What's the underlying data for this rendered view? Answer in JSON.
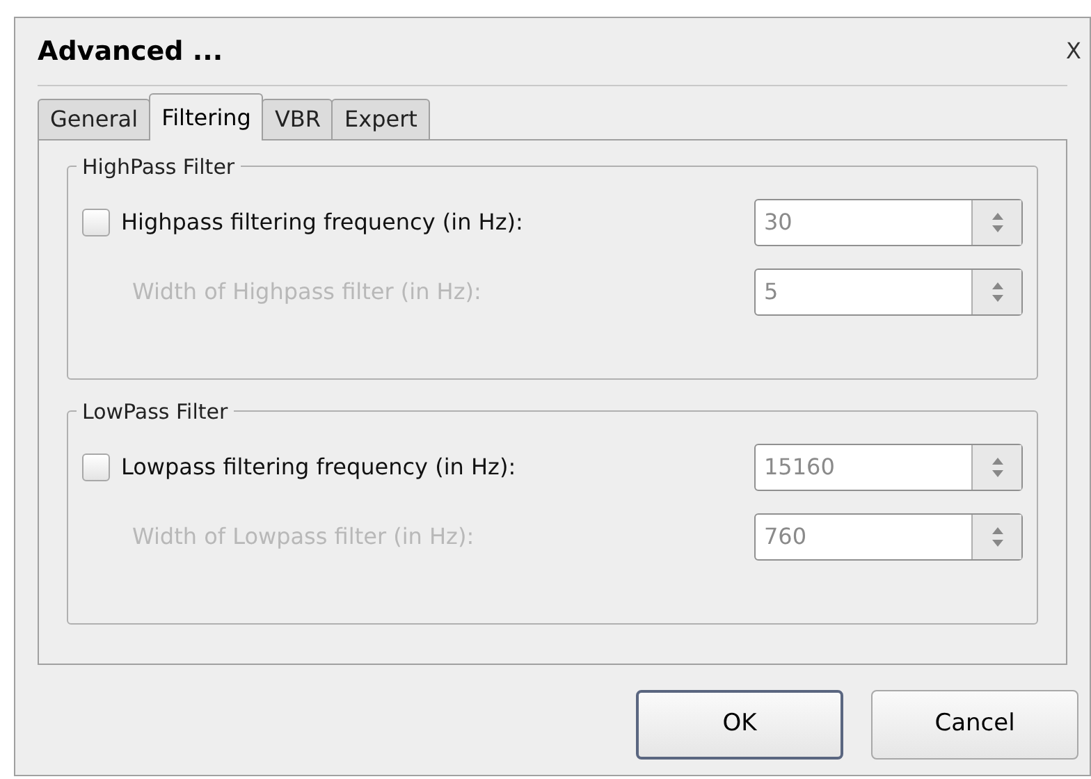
{
  "window": {
    "title": "Advanced ...",
    "close": "X"
  },
  "tabs": [
    {
      "label": "General",
      "selected": false
    },
    {
      "label": "Filtering",
      "selected": true
    },
    {
      "label": "VBR",
      "selected": false
    },
    {
      "label": "Expert",
      "selected": false
    }
  ],
  "groups": [
    {
      "title": "HighPass Filter",
      "rows": [
        {
          "kind": "checkbox",
          "label": "Highpass filtering frequency (in Hz):",
          "checked": false,
          "disabled": false,
          "field": {
            "value": "30",
            "disabled": true
          }
        },
        {
          "kind": "label",
          "label": "Width of Highpass filter (in Hz):",
          "disabled": true,
          "field": {
            "value": "5",
            "disabled": true
          }
        }
      ]
    },
    {
      "title": "LowPass Filter",
      "rows": [
        {
          "kind": "checkbox",
          "label": "Lowpass filtering frequency (in Hz):",
          "checked": false,
          "disabled": false,
          "field": {
            "value": "15160",
            "disabled": true
          }
        },
        {
          "kind": "label",
          "label": "Width of Lowpass filter (in Hz):",
          "disabled": true,
          "field": {
            "value": "760",
            "disabled": true
          }
        }
      ]
    }
  ],
  "buttons": [
    {
      "label": "OK",
      "default": true
    },
    {
      "label": "Cancel",
      "default": false
    }
  ]
}
